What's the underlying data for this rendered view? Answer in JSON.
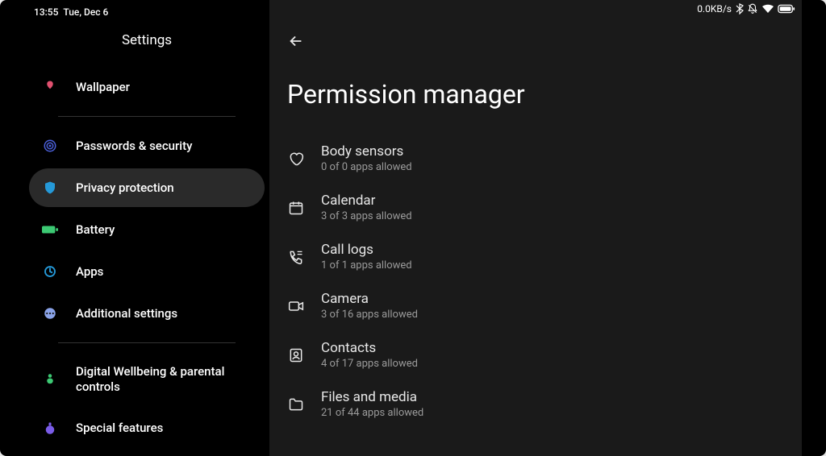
{
  "statusbar": {
    "time": "13:55",
    "date": "Tue, Dec 6",
    "speed": "0.0KB/s"
  },
  "sidebar": {
    "title": "Settings",
    "items": [
      {
        "label": "Wallpaper"
      },
      {
        "label": "Passwords & security"
      },
      {
        "label": "Privacy protection"
      },
      {
        "label": "Battery"
      },
      {
        "label": "Apps"
      },
      {
        "label": "Additional settings"
      },
      {
        "label": "Digital Wellbeing & parental controls"
      },
      {
        "label": "Special features"
      }
    ]
  },
  "page": {
    "title": "Permission manager"
  },
  "permissions": [
    {
      "title": "Body sensors",
      "sub": "0 of 0 apps allowed"
    },
    {
      "title": "Calendar",
      "sub": "3 of 3 apps allowed"
    },
    {
      "title": "Call logs",
      "sub": "1 of 1 apps allowed"
    },
    {
      "title": "Camera",
      "sub": "3 of 16 apps allowed"
    },
    {
      "title": "Contacts",
      "sub": "4 of 17 apps allowed"
    },
    {
      "title": "Files and media",
      "sub": "21 of 44 apps allowed"
    }
  ]
}
